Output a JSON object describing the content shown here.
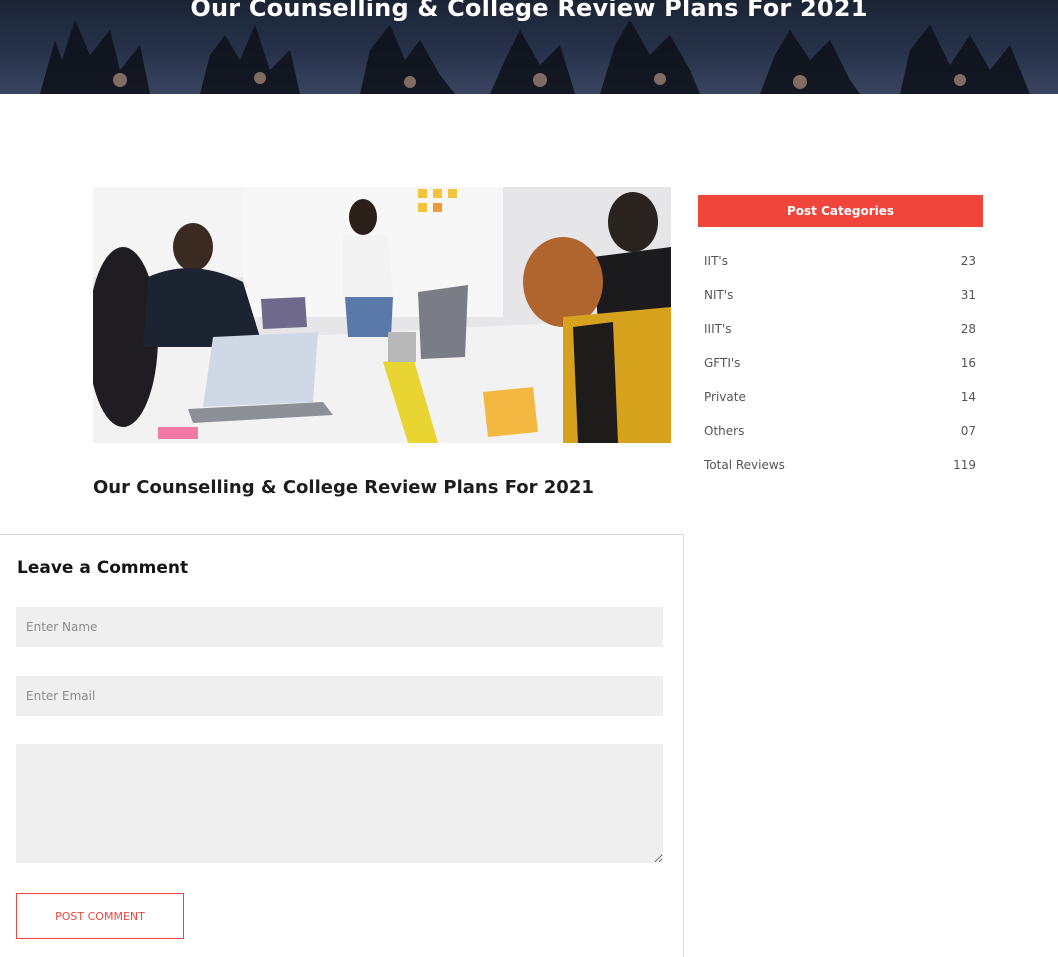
{
  "hero": {
    "title": "Our Counselling & College Review Plans For 2021"
  },
  "post": {
    "title": "Our Counselling & College Review Plans For 2021"
  },
  "sidebar": {
    "heading": "Post Categories",
    "categories": [
      {
        "label": "IIT's",
        "count": "23"
      },
      {
        "label": "NIT's",
        "count": "31"
      },
      {
        "label": "IIIT's",
        "count": "28"
      },
      {
        "label": "GFTI's",
        "count": "16"
      },
      {
        "label": "Private",
        "count": "14"
      },
      {
        "label": "Others",
        "count": "07"
      },
      {
        "label": "Total Reviews",
        "count": "119"
      }
    ]
  },
  "comment_form": {
    "heading": "Leave a Comment",
    "name_placeholder": "Enter Name",
    "email_placeholder": "Enter Email",
    "message_placeholder": "",
    "submit_label": "POST COMMENT"
  },
  "colors": {
    "accent": "#f0453a",
    "hero_bg": "#1b2435",
    "field_bg": "#efefef"
  }
}
